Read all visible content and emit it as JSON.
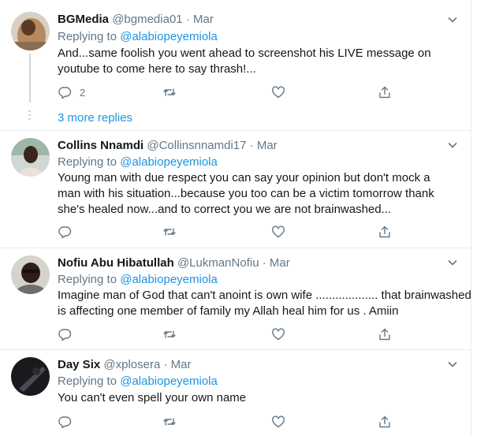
{
  "tweets": [
    {
      "name": "BGMedia",
      "handle": "@bgmedia01",
      "date": "· Mar",
      "replying_label": "Replying to",
      "mention": "@alabiopeyemiola",
      "lines": [
        "And...same foolish you went ahead to screenshot his LIVE message on",
        "youtube to come here to say thrash!..."
      ],
      "reply_count": "2"
    },
    {
      "name": "Collins Nnamdi",
      "handle": "@Collinsnnamdi17",
      "date": "· Mar",
      "replying_label": "Replying to",
      "mention": "@alabiopeyemiola",
      "lines": [
        "Young man with due respect you can say your opinion but don't mock a",
        "man with his situation...because you too can be a victim tomorrow thank",
        "she's healed now...and to correct you we are not brainwashed..."
      ]
    },
    {
      "name": "Nofiu Abu Hibatullah",
      "handle": "@LukmanNofiu",
      "date": "· Mar",
      "replying_label": "Replying to",
      "mention": "@alabiopeyemiola",
      "lines": [
        "Imagine man of God that can't anoint is own wife ................... that brainwashed",
        "is affecting one member of family my Allah heal him for us . Amiin"
      ]
    },
    {
      "name": "Day Six",
      "handle": "@xplosera",
      "date": "· Mar",
      "replying_label": "Replying to",
      "mention": "@alabiopeyemiola",
      "lines": [
        "You can't even spell your own name"
      ]
    }
  ],
  "thread": {
    "more_replies": "3 more replies"
  },
  "icons": {
    "reply": "reply-icon",
    "retweet": "retweet-icon",
    "like": "heart-icon",
    "share": "share-icon",
    "caret": "chevron-down-icon"
  },
  "colors": {
    "link": "#1b95e0",
    "secondary": "#657786",
    "text": "#14171a",
    "border": "#e6ecf0"
  }
}
